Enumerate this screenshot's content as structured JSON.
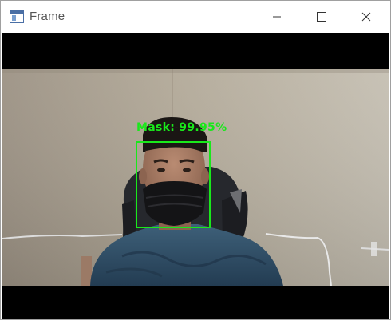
{
  "window": {
    "title": "Frame",
    "icon": "app-frame-icon",
    "controls": [
      "minimize-icon",
      "maximize-icon",
      "close-icon"
    ]
  },
  "frame": {
    "detection": {
      "label": "Mask:  99.95%",
      "class": "Mask",
      "confidence_percent": 99.95,
      "box_color": "#19e81b"
    }
  }
}
